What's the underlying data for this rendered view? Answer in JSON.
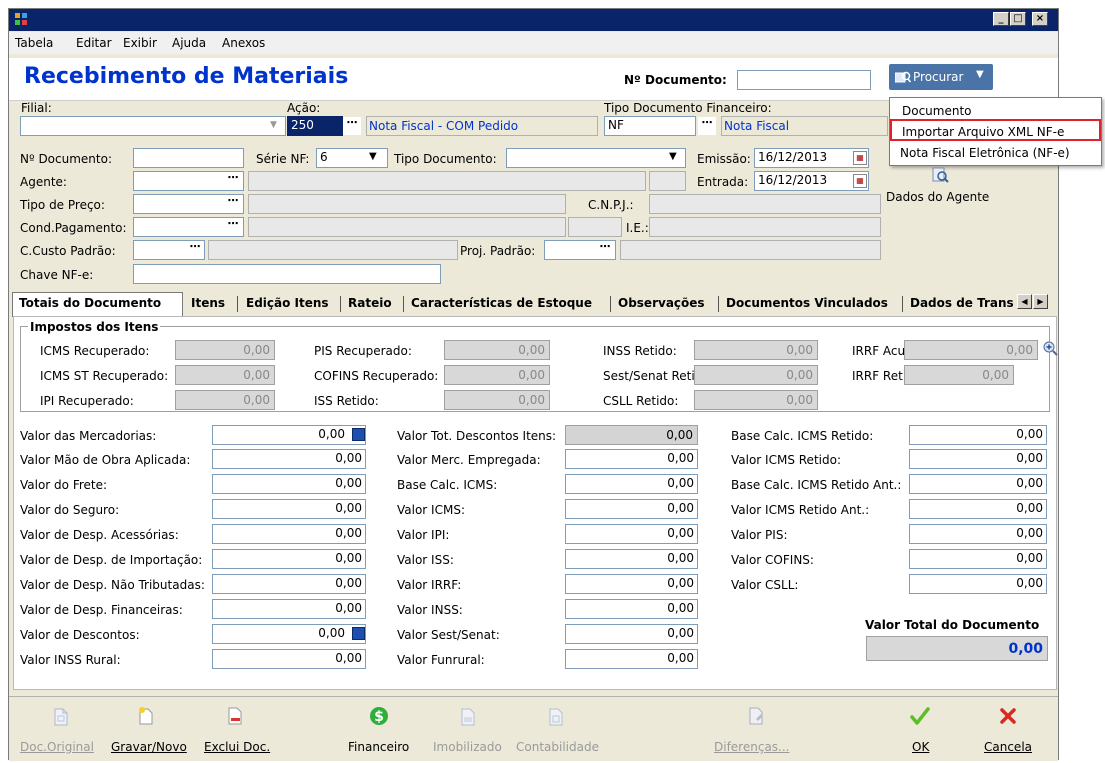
{
  "window": {
    "menu": [
      "Tabela",
      "Editar",
      "Exibir",
      "Ajuda",
      "Anexos"
    ],
    "controls": [
      "_",
      "□",
      "×"
    ]
  },
  "header": {
    "title": "Recebimento de Materiais",
    "doc_label": "Nº Documento:",
    "doc_value": "",
    "search_label": "Procurar",
    "search_menu": [
      "Documento",
      "Importar Arquivo XML NF-e",
      "Nota Fiscal Eletrônica (NF-e)"
    ]
  },
  "top": {
    "filial_label": "Filial:",
    "filial_value": "",
    "acao_label": "Ação:",
    "acao_value": "250",
    "acao_desc": "Nota Fiscal - COM Pedido",
    "tipo_fin_label": "Tipo Documento Financeiro:",
    "tipo_fin_value": "NF",
    "tipo_fin_desc": "Nota Fiscal"
  },
  "form": {
    "ndoc_label": "Nº Documento:",
    "ndoc_value": "",
    "serie_label": "Série NF:",
    "serie_value": "6",
    "tipodoc_label": "Tipo Documento:",
    "tipodoc_value": "",
    "emissao_label": "Emissão:",
    "emissao_value": "16/12/2013",
    "entrada_label": "Entrada:",
    "entrada_value": "16/12/2013",
    "agente_label": "Agente:",
    "tipopreco_label": "Tipo de Preço:",
    "cnpj_label": "C.N.P.J.:",
    "condpag_label": "Cond.Pagamento:",
    "ie_label": "I.E.:",
    "ccusto_label": "C.Custo Padrão:",
    "proj_label": "Proj. Padrão:",
    "chave_label": "Chave NF-e:",
    "chave_value": "",
    "dados_agente": "Dados do Agente"
  },
  "tabs": [
    "Totais do Documento",
    "Itens",
    "Edição Itens",
    "Rateio",
    "Características de Estoque",
    "Observações",
    "Documentos Vinculados",
    "Dados de Trans"
  ],
  "impostos": {
    "legend": "Impostos dos Itens",
    "items": [
      {
        "label": "ICMS Recuperado:",
        "value": "0,00"
      },
      {
        "label": "PIS Recuperado:",
        "value": "0,00"
      },
      {
        "label": "INSS Retido:",
        "value": "0,00"
      },
      {
        "label": "IRRF Acum.:",
        "value": "0,00"
      },
      {
        "label": "ICMS ST Recuperado:",
        "value": "0,00"
      },
      {
        "label": "COFINS Recuperado:",
        "value": "0,00"
      },
      {
        "label": "Sest/Senat Retido:",
        "value": "0,00"
      },
      {
        "label": "IRRF Retido:",
        "value": "0,00"
      },
      {
        "label": "IPI Recuperado:",
        "value": "0,00"
      },
      {
        "label": "ISS Retido:",
        "value": "0,00"
      },
      {
        "label": "CSLL Retido:",
        "value": "0,00"
      }
    ]
  },
  "col1": [
    {
      "label": "Valor das Mercadorias:",
      "value": "0,00"
    },
    {
      "label": "Valor Mão de Obra Aplicada:",
      "value": "0,00"
    },
    {
      "label": "Valor do Frete:",
      "value": "0,00"
    },
    {
      "label": "Valor do Seguro:",
      "value": "0,00"
    },
    {
      "label": "Valor de Desp. Acessórias:",
      "value": "0,00"
    },
    {
      "label": "Valor de Desp. de Importação:",
      "value": "0,00"
    },
    {
      "label": "Valor de Desp. Não Tributadas:",
      "value": "0,00"
    },
    {
      "label": "Valor de Desp. Financeiras:",
      "value": "0,00"
    },
    {
      "label": "Valor de Descontos:",
      "value": "0,00"
    },
    {
      "label": "Valor INSS Rural:",
      "value": "0,00"
    }
  ],
  "col2": [
    {
      "label": "Valor Tot. Descontos Itens:",
      "value": "0,00"
    },
    {
      "label": "Valor Merc. Empregada:",
      "value": "0,00"
    },
    {
      "label": "Base Calc. ICMS:",
      "value": "0,00"
    },
    {
      "label": "Valor ICMS:",
      "value": "0,00"
    },
    {
      "label": "Valor IPI:",
      "value": "0,00"
    },
    {
      "label": "Valor ISS:",
      "value": "0,00"
    },
    {
      "label": "Valor IRRF:",
      "value": "0,00"
    },
    {
      "label": "Valor INSS:",
      "value": "0,00"
    },
    {
      "label": "Valor Sest/Senat:",
      "value": "0,00"
    },
    {
      "label": "Valor Funrural:",
      "value": "0,00"
    }
  ],
  "col3": [
    {
      "label": "Base Calc. ICMS Retido:",
      "value": "0,00"
    },
    {
      "label": "Valor ICMS Retido:",
      "value": "0,00"
    },
    {
      "label": "Base Calc. ICMS Retido Ant.:",
      "value": "0,00"
    },
    {
      "label": "Valor ICMS Retido Ant.:",
      "value": "0,00"
    },
    {
      "label": "Valor PIS:",
      "value": "0,00"
    },
    {
      "label": "Valor COFINS:",
      "value": "0,00"
    },
    {
      "label": "Valor CSLL:",
      "value": "0,00"
    }
  ],
  "total": {
    "label": "Valor Total do Documento",
    "value": "0,00"
  },
  "toolbar": {
    "doc_original": "Doc.Original",
    "gravar_novo": "Gravar/Novo",
    "exclui_doc": "Exclui Doc.",
    "financeiro": "Financeiro",
    "imobilizado": "Imobilizado",
    "contabilidade": "Contabilidade",
    "diferencas": "Diferenças...",
    "ok": "OK",
    "cancela": "Cancela"
  },
  "colors": {
    "title_blue": "#0033cc",
    "highlight_red": "#e0202a",
    "titlebar": "#0a246a"
  }
}
